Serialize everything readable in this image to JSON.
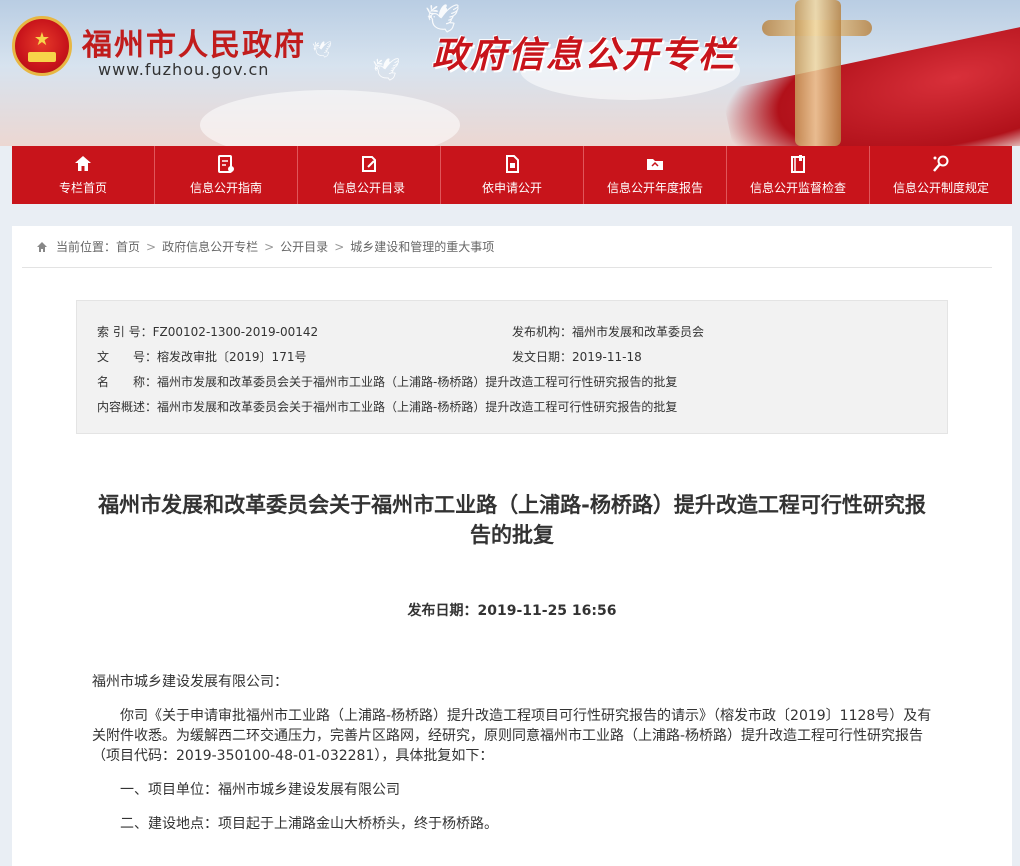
{
  "header": {
    "site_name": "福州市人民政府",
    "site_url": "www.fuzhou.gov.cn",
    "column_title": "政府信息公开专栏"
  },
  "nav": {
    "items": [
      {
        "label": "专栏首页",
        "icon": "home-icon"
      },
      {
        "label": "信息公开指南",
        "icon": "guide-icon"
      },
      {
        "label": "信息公开目录",
        "icon": "catalog-icon"
      },
      {
        "label": "依申请公开",
        "icon": "document-icon"
      },
      {
        "label": "信息公开年度报告",
        "icon": "folder-icon"
      },
      {
        "label": "信息公开监督检查",
        "icon": "inspection-icon"
      },
      {
        "label": "信息公开制度规定",
        "icon": "search-regulation-icon"
      }
    ]
  },
  "breadcrumb": {
    "prefix": "当前位置：",
    "items": [
      "首页",
      "政府信息公开专栏",
      "公开目录",
      "城乡建设和管理的重大事项"
    ]
  },
  "meta": {
    "index_label": "索 引 号：",
    "index_value": "FZ00102-1300-2019-00142",
    "publisher_label": "发布机构：",
    "publisher_value": "福州市发展和改革委员会",
    "docno_label": "文　　号：",
    "docno_value": "榕发改审批〔2019〕171号",
    "date_label": "发文日期：",
    "date_value": "2019-11-18",
    "name_label": "名　　称：",
    "name_value": "福州市发展和改革委员会关于福州市工业路（上浦路-杨桥路）提升改造工程可行性研究报告的批复",
    "summary_label": "内容概述：",
    "summary_value": "福州市发展和改革委员会关于福州市工业路（上浦路-杨桥路）提升改造工程可行性研究报告的批复"
  },
  "article": {
    "title": "福州市发展和改革委员会关于福州市工业路（上浦路-杨桥路）提升改造工程可行性研究报告的批复",
    "pubdate_label": "发布日期：",
    "pubdate_value": "2019-11-25 16:56",
    "salutation": "福州市城乡建设发展有限公司：",
    "paragraph1": "你司《关于申请审批福州市工业路（上浦路-杨桥路）提升改造工程项目可行性研究报告的请示》（榕发市政〔2019〕1128号）及有关附件收悉。为缓解西二环交通压力，完善片区路网，经研究，原则同意福州市工业路（上浦路-杨桥路）提升改造工程可行性研究报告（项目代码：2019-350100-48-01-032281），具体批复如下：",
    "item1": "一、项目单位：福州市城乡建设发展有限公司",
    "item2": "二、建设地点：项目起于上浦路金山大桥桥头，终于杨桥路。"
  },
  "colors": {
    "brand_red": "#c8141b",
    "background": "#e9eef4"
  }
}
